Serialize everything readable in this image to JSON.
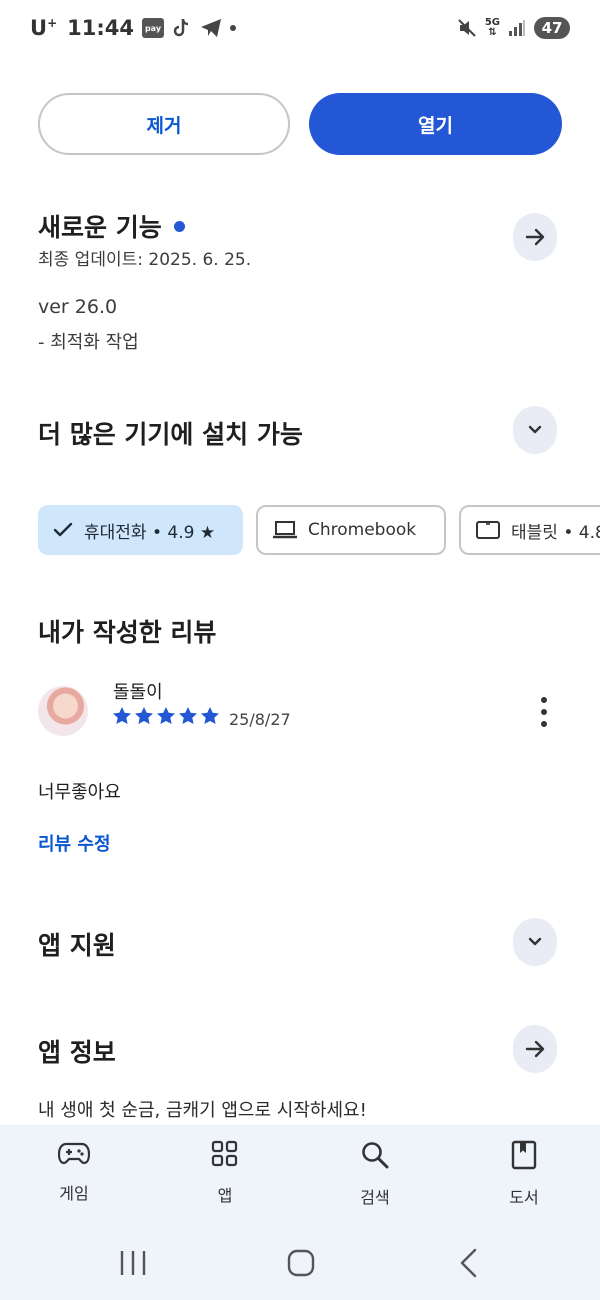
{
  "status_bar": {
    "carrier": "U",
    "carrier_sup": "+",
    "time": "11:44",
    "pay_label": "pay",
    "network": "5G",
    "battery": "47"
  },
  "actions": {
    "remove_label": "제거",
    "open_label": "열기"
  },
  "whats_new": {
    "title": "새로운 기능",
    "updated": "최종 업데이트: 2025. 6. 25.",
    "version": "ver 26.0",
    "notes": "- 최적화 작업"
  },
  "devices": {
    "title": "더 많은 기기에 설치 가능",
    "chips": [
      {
        "label": "휴대전화 • 4.9 ★",
        "icon": "check-icon"
      },
      {
        "label": "Chromebook",
        "icon": "laptop-icon"
      },
      {
        "label": "태블릿 • 4.8",
        "icon": "tablet-icon"
      }
    ]
  },
  "my_review": {
    "title": "내가 작성한 리뷰",
    "reviewer": "돌돌이",
    "rating": 5,
    "date": "25/8/27",
    "text": "너무좋아요",
    "edit_label": "리뷰 수정"
  },
  "app_support": {
    "title": "앱 지원"
  },
  "app_info": {
    "title": "앱 정보",
    "description": "내 생애 첫 순금, 금캐기 앱으로 시작하세요!"
  },
  "bottom_nav": [
    {
      "label": "게임",
      "icon": "gamepad-icon"
    },
    {
      "label": "앱",
      "icon": "apps-grid-icon"
    },
    {
      "label": "검색",
      "icon": "search-icon"
    },
    {
      "label": "도서",
      "icon": "book-icon"
    }
  ],
  "colors": {
    "accent": "#2457d6",
    "link": "#0b57d0",
    "chip_selected": "#cfe6fb",
    "nav_bg": "#eff3fa"
  }
}
